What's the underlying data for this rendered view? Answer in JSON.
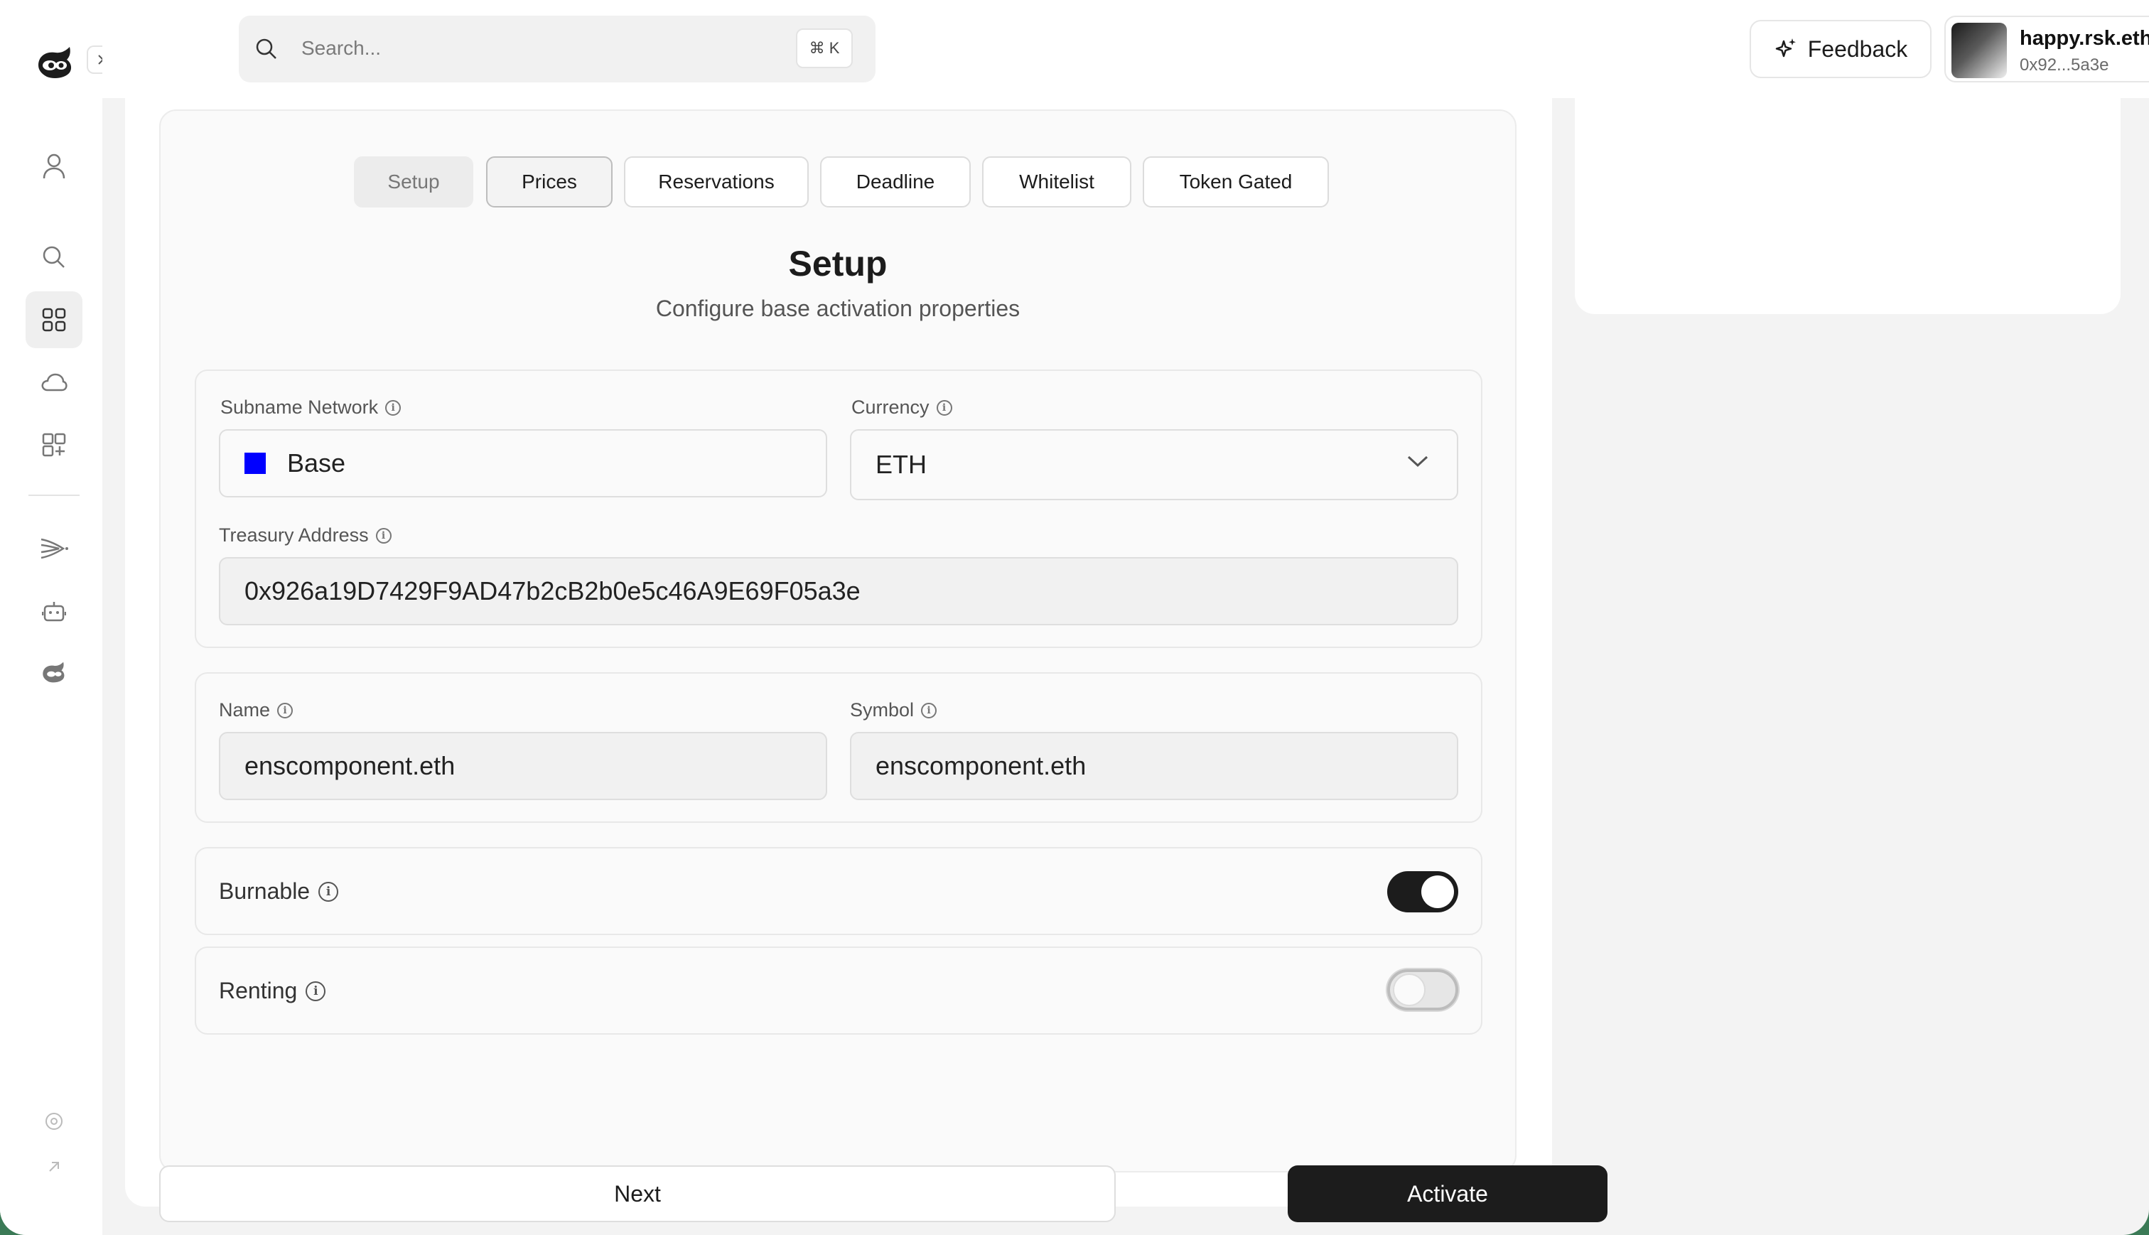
{
  "search": {
    "placeholder": "Search...",
    "shortcut": "⌘ K"
  },
  "header": {
    "feedback_label": "Feedback",
    "account_name": "happy.rsk.eth",
    "account_address": "0x92...5a3e"
  },
  "tabs": [
    {
      "label": "Setup"
    },
    {
      "label": "Prices"
    },
    {
      "label": "Reservations"
    },
    {
      "label": "Deadline"
    },
    {
      "label": "Whitelist"
    },
    {
      "label": "Token Gated"
    }
  ],
  "section": {
    "title": "Setup",
    "subtitle": "Configure base activation properties"
  },
  "form": {
    "subname_network": {
      "label": "Subname Network",
      "value": "Base",
      "color": "#0000ff"
    },
    "currency": {
      "label": "Currency",
      "value": "ETH"
    },
    "treasury": {
      "label": "Treasury Address",
      "value": "0x926a19D7429F9AD47b2cB2b0e5c46A9E69F05a3e"
    },
    "name": {
      "label": "Name",
      "value": "enscomponent.eth"
    },
    "symbol": {
      "label": "Symbol",
      "value": "enscomponent.eth"
    },
    "burnable": {
      "label": "Burnable",
      "enabled": true
    },
    "renting": {
      "label": "Renting",
      "enabled": false
    }
  },
  "actions": {
    "next_label": "Next",
    "activate_label": "Activate"
  },
  "sidebar": {
    "icons": [
      "user-icon",
      "search-icon",
      "dashboard-icon",
      "cloud-icon",
      "add-widget-icon",
      "send-icon",
      "bot-icon",
      "brand-icon",
      "settings-icon",
      "external-link-icon"
    ]
  }
}
